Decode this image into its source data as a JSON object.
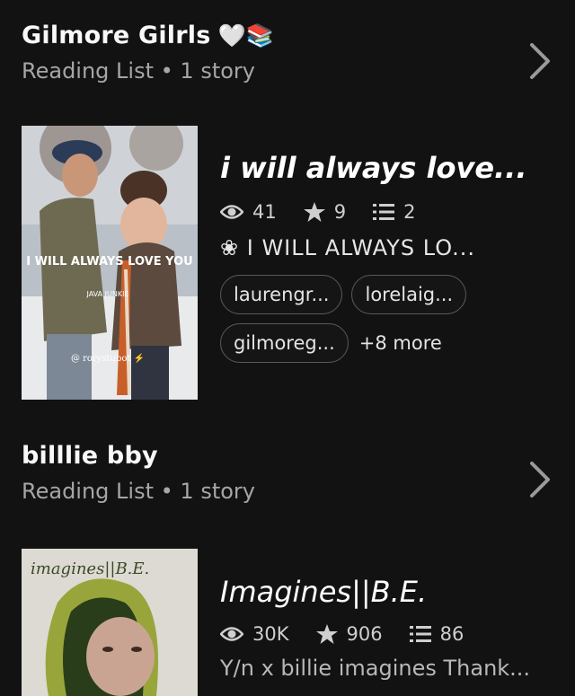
{
  "lists": [
    {
      "title": "Gilmore Gilrls",
      "emoji": "🤍📚",
      "subtitle": "Reading List • 1 story",
      "story": {
        "title": "i will always love...",
        "views": "41",
        "votes": "9",
        "parts": "2",
        "description": "❀ I WILL ALWAYS LO...",
        "tags": [
          "laurengr...",
          "lorelaig...",
          "gilmoreg..."
        ],
        "more_tags": "+8 more",
        "cover_text": {
          "title": "I WILL ALWAYS LOVE YOU",
          "subtitle": "JAVA JUNKIE",
          "credit": "@ rorystubot ⚡"
        }
      }
    },
    {
      "title": "billlie bby",
      "subtitle": "Reading List • 1 story",
      "story": {
        "title": "Imagines||B.E.",
        "views": "30K",
        "votes": "906",
        "parts": "86",
        "description": "Y/n x billie imagines Thank...",
        "cover_text": {
          "title": "imagines||B.E."
        }
      }
    }
  ]
}
